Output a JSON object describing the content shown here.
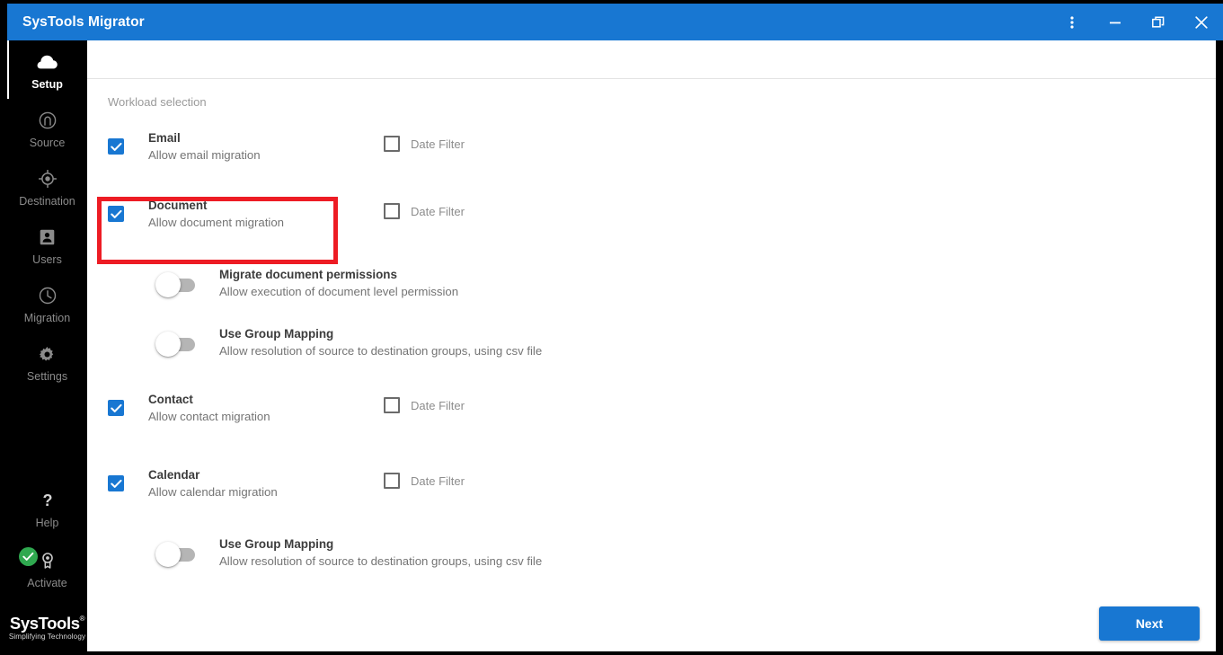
{
  "window": {
    "title": "SysTools Migrator",
    "accent_color": "#1877d2",
    "controls": [
      {
        "name": "more-options",
        "icon": "kebab-menu-icon"
      },
      {
        "name": "minimize",
        "icon": "minimize-icon"
      },
      {
        "name": "restore",
        "icon": "restore-icon"
      },
      {
        "name": "close",
        "icon": "close-icon"
      }
    ]
  },
  "sidebar": {
    "items": [
      {
        "label": "Setup",
        "icon": "cloud-icon",
        "active": true
      },
      {
        "label": "Source",
        "icon": "source-icon",
        "active": false
      },
      {
        "label": "Destination",
        "icon": "destination-icon",
        "active": false
      },
      {
        "label": "Users",
        "icon": "users-icon",
        "active": false
      },
      {
        "label": "Migration",
        "icon": "clock-icon",
        "active": false
      },
      {
        "label": "Settings",
        "icon": "gear-icon",
        "active": false
      }
    ],
    "help": {
      "label": "Help",
      "icon": "question-mark-icon"
    },
    "activate": {
      "label": "Activate",
      "icon": "badge-icon",
      "status_icon": "green-check-icon",
      "status_color": "#2fa84f"
    },
    "brand": {
      "name": "SysTools",
      "registered": "®",
      "tagline": "Simplifying Technology"
    }
  },
  "main": {
    "section_label": "Workload selection",
    "date_filter_label": "Date Filter",
    "next_label": "Next",
    "workloads": [
      {
        "title": "Email",
        "subtitle": "Allow email migration",
        "checked": true,
        "has_date_filter": true,
        "date_filter_checked": false,
        "highlighted": false
      },
      {
        "title": "Document",
        "subtitle": "Allow document migration",
        "checked": true,
        "has_date_filter": true,
        "date_filter_checked": false,
        "highlighted": true
      },
      {
        "title": "Contact",
        "subtitle": "Allow contact migration",
        "checked": true,
        "has_date_filter": true,
        "date_filter_checked": false,
        "highlighted": false
      },
      {
        "title": "Calendar",
        "subtitle": "Allow calendar migration",
        "checked": true,
        "has_date_filter": true,
        "date_filter_checked": false,
        "highlighted": false
      }
    ],
    "document_options": [
      {
        "title": "Migrate document permissions",
        "subtitle": "Allow execution of document level permission",
        "enabled": false
      },
      {
        "title": "Use Group Mapping",
        "subtitle": "Allow resolution of source to destination groups, using csv file",
        "enabled": false
      }
    ],
    "calendar_options": [
      {
        "title": "Use Group Mapping",
        "subtitle": "Allow resolution of source to destination groups, using csv file",
        "enabled": false
      }
    ]
  }
}
